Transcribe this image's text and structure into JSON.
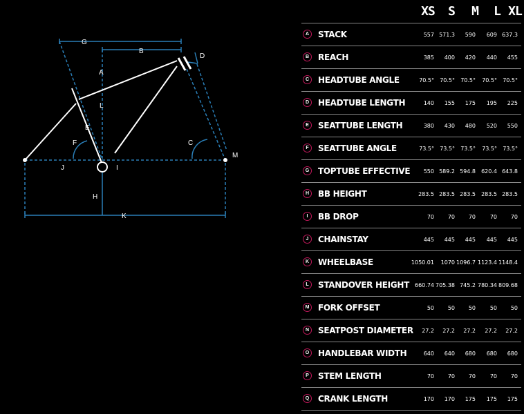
{
  "diagram": {
    "labels": {
      "A": "A",
      "B": "B",
      "C": "C",
      "D": "D",
      "E": "E",
      "F": "F",
      "G": "G",
      "H": "H",
      "I": "I",
      "J": "J",
      "K": "K",
      "L": "L",
      "M": "M"
    }
  },
  "table": {
    "sizes": [
      "XS",
      "S",
      "M",
      "L",
      "XL"
    ],
    "rows": [
      {
        "key": "A",
        "label": "STACK",
        "values": [
          "557",
          "571.3",
          "590",
          "609",
          "637.3"
        ]
      },
      {
        "key": "B",
        "label": "REACH",
        "values": [
          "385",
          "400",
          "420",
          "440",
          "455"
        ]
      },
      {
        "key": "C",
        "label": "HEADTUBE ANGLE",
        "values": [
          "70.5°",
          "70.5°",
          "70.5°",
          "70.5°",
          "70.5°"
        ]
      },
      {
        "key": "D",
        "label": "HEADTUBE LENGTH",
        "values": [
          "140",
          "155",
          "175",
          "195",
          "225"
        ]
      },
      {
        "key": "E",
        "label": "SEATTUBE LENGTH",
        "values": [
          "380",
          "430",
          "480",
          "520",
          "550"
        ]
      },
      {
        "key": "F",
        "label": "SEATTUBE ANGLE",
        "values": [
          "73.5°",
          "73.5°",
          "73.5°",
          "73.5°",
          "73.5°"
        ]
      },
      {
        "key": "G",
        "label": "TOPTUBE EFFECTIVE",
        "values": [
          "550",
          "589.2",
          "594.8",
          "620.4",
          "643.8"
        ]
      },
      {
        "key": "H",
        "label": "BB HEIGHT",
        "values": [
          "283.5",
          "283.5",
          "283.5",
          "283.5",
          "283.5"
        ]
      },
      {
        "key": "I",
        "label": "BB DROP",
        "values": [
          "70",
          "70",
          "70",
          "70",
          "70"
        ]
      },
      {
        "key": "J",
        "label": "CHAINSTAY",
        "values": [
          "445",
          "445",
          "445",
          "445",
          "445"
        ]
      },
      {
        "key": "K",
        "label": "WHEELBASE",
        "values": [
          "1050.01",
          "1070",
          "1096.7",
          "1123.4",
          "1148.4"
        ]
      },
      {
        "key": "L",
        "label": "STANDOVER HEIGHT",
        "values": [
          "660.74",
          "705.38",
          "745.2",
          "780.34",
          "809.68"
        ]
      },
      {
        "key": "M",
        "label": "FORK OFFSET",
        "values": [
          "50",
          "50",
          "50",
          "50",
          "50"
        ]
      },
      {
        "key": "N",
        "label": "SEATPOST DIAMETER",
        "values": [
          "27.2",
          "27.2",
          "27.2",
          "27.2",
          "27.2"
        ]
      },
      {
        "key": "O",
        "label": "HANDLEBAR WIDTH",
        "values": [
          "640",
          "640",
          "680",
          "680",
          "680"
        ]
      },
      {
        "key": "P",
        "label": "STEM LENGTH",
        "values": [
          "70",
          "70",
          "70",
          "70",
          "70"
        ]
      },
      {
        "key": "Q",
        "label": "CRANK LENGTH",
        "values": [
          "170",
          "170",
          "175",
          "175",
          "175"
        ]
      }
    ]
  }
}
